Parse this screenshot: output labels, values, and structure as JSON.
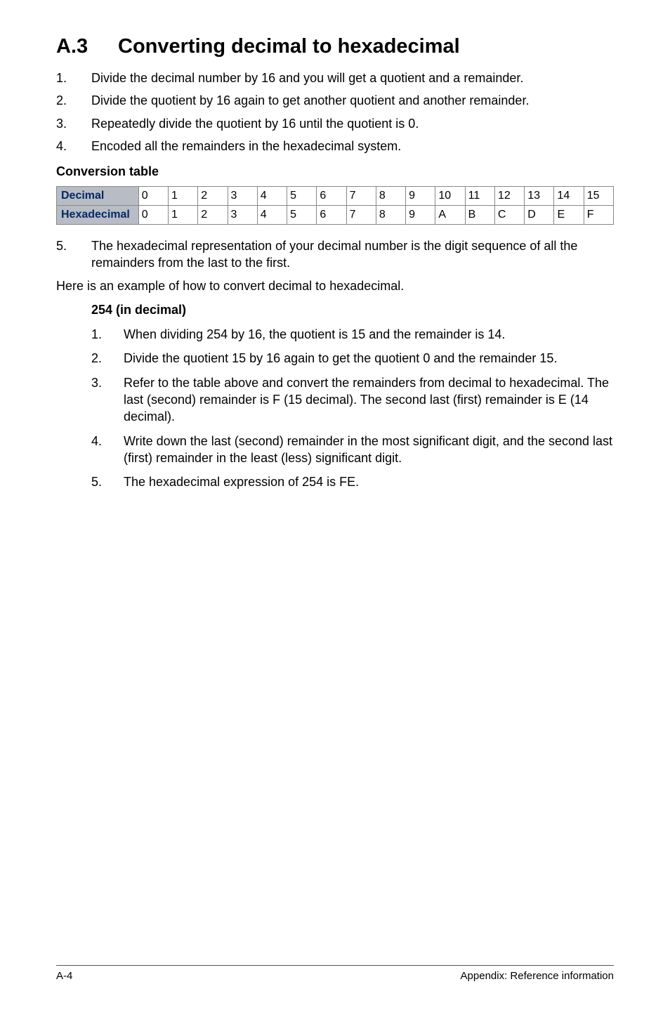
{
  "heading": {
    "number": "A.3",
    "title": "Converting decimal to hexadecimal"
  },
  "steps_top": [
    "Divide the decimal number by 16 and you will get a quotient and a remainder.",
    "Divide the quotient by 16 again to get another quotient and another remainder.",
    "Repeatedly divide the quotient by 16 until the quotient is 0.",
    "Encoded all the remainders in the hexadecimal system."
  ],
  "table_caption": "Conversion table",
  "chart_data": {
    "type": "table",
    "rows": [
      {
        "label": "Decimal",
        "values": [
          "0",
          "1",
          "2",
          "3",
          "4",
          "5",
          "6",
          "7",
          "8",
          "9",
          "10",
          "11",
          "12",
          "13",
          "14",
          "15"
        ]
      },
      {
        "label": "Hexadecimal",
        "values": [
          "0",
          "1",
          "2",
          "3",
          "4",
          "5",
          "6",
          "7",
          "8",
          "9",
          "A",
          "B",
          "C",
          "D",
          "E",
          "F"
        ]
      }
    ]
  },
  "step5": "The hexadecimal representation of your decimal number is the digit sequence of all the remainders from the last to the first.",
  "para_example_intro": "Here is an example of how to convert decimal to hexadecimal.",
  "example_title": "254 (in decimal)",
  "example_steps": [
    "When dividing 254 by 16, the quotient is 15 and the remainder is 14.",
    "Divide the quotient 15 by 16 again to get the quotient 0 and the remainder 15.",
    "Refer to the table above and convert the remainders from decimal to hexadecimal. The last (second) remainder is F (15 decimal). The second last (first) remainder is E (14 decimal).",
    "Write down the last (second) remainder in the most significant digit, and the second last (first) remainder in the least (less) significant digit.",
    "The hexadecimal expression of 254 is FE."
  ],
  "footer": {
    "left": "A-4",
    "right": "Appendix: Reference information"
  }
}
